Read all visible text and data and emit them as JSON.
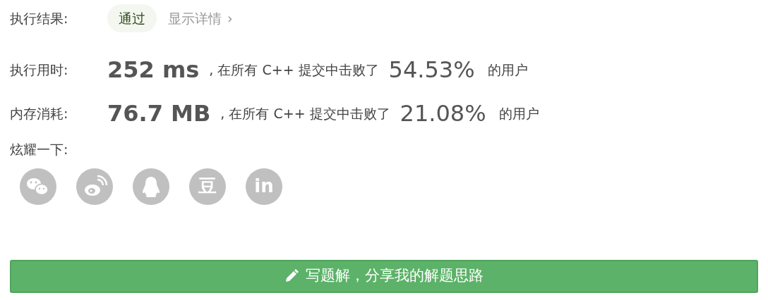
{
  "result": {
    "label": "执行结果:",
    "status": "通过",
    "details_link": "显示详情",
    "details_arrow": "›"
  },
  "stats": [
    {
      "label": "执行用时:",
      "value": "252 ms",
      "middle": ", 在所有 C++ 提交中击败了",
      "percent": "54.53%",
      "suffix": "的用户"
    },
    {
      "label": "内存消耗:",
      "value": "76.7 MB",
      "middle": ", 在所有 C++ 提交中击败了",
      "percent": "21.08%",
      "suffix": "的用户"
    }
  ],
  "share": {
    "label": "炫耀一下:",
    "buttons": [
      {
        "kind": "chat"
      },
      {
        "kind": "eye"
      },
      {
        "kind": "penguin"
      },
      {
        "kind": "glyph",
        "text": "豆"
      },
      {
        "kind": "glyph",
        "text": "in"
      }
    ]
  },
  "write_button": {
    "label": "写题解，分享我的解题思路"
  }
}
